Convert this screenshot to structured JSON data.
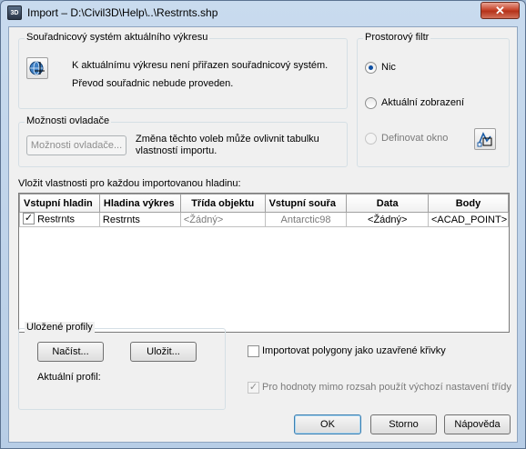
{
  "window": {
    "title": "Import – D:\\Civil3D\\Help\\..\\Restrnts.shp",
    "app_icon_text": "3D",
    "close_glyph": "✕"
  },
  "coord_group": {
    "title": "Souřadnicový systém aktuálního výkresu",
    "line1": "K aktuálnímu výkresu není přiřazen souřadnicový systém.",
    "line2": "Převod souřadnic nebude proveden."
  },
  "spatial_filter": {
    "title": "Prostorový filtr",
    "option_none": "Nic",
    "option_current_view": "Aktuální zobrazení",
    "option_define_window": "Definovat okno",
    "selected": "Nic"
  },
  "driver_group": {
    "title": "Možnosti ovladače",
    "button": "Možnosti ovladače...",
    "note": "Změna těchto voleb může ovlivnit tabulku vlastností importu."
  },
  "layers": {
    "label": "Vložit vlastnosti pro každou importovanou hladinu:",
    "columns": [
      "Vstupní hladin",
      "Hladina výkres",
      "Třída objektu",
      "Vstupní souřa",
      "Data",
      "Body"
    ],
    "rows": [
      {
        "checked": true,
        "input_layer": "Restrnts",
        "drawing_layer": "Restrnts",
        "object_class": "<Žádný>",
        "input_coords": "Antarctic98",
        "data": "<Žádný>",
        "points": "<ACAD_POINT>"
      }
    ]
  },
  "profiles": {
    "title": "Uložené profily",
    "load_button": "Načíst...",
    "save_button": "Uložit...",
    "current_label": "Aktuální profil:"
  },
  "options": {
    "import_polygons": "Importovat polygony jako uzavřené křivky",
    "import_polygons_checked": false,
    "use_defaults": "Pro hodnoty mimo rozsah použít výchozí nastavení třídy",
    "use_defaults_checked": true
  },
  "buttons": {
    "ok": "OK",
    "cancel": "Storno",
    "help": "Nápověda"
  }
}
